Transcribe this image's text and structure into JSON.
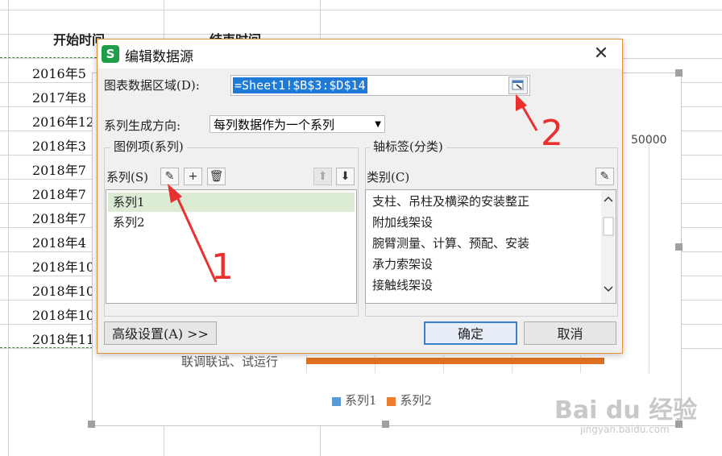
{
  "sheet": {
    "headers": [
      "开始时间",
      "结束时间"
    ],
    "start_dates": [
      "2016年5",
      "2017年8",
      "2016年12",
      "2018年3",
      "2018年7",
      "2018年7",
      "2018年7",
      "2018年4",
      "2018年10",
      "2018年10",
      "2018年10",
      "2018年11"
    ]
  },
  "chart": {
    "axis_value": "50000",
    "row_label": "联调联试、试运行",
    "legend": [
      {
        "name": "系列1",
        "color": "#5b9bd5"
      },
      {
        "name": "系列2",
        "color": "#ed7d31"
      }
    ]
  },
  "dialog": {
    "app_icon": "S",
    "title": "编辑数据源",
    "close_glyph": "✕",
    "range_label": "图表数据区域(D):",
    "range_value": "=Sheet1!$B$3:$D$14",
    "direction_label": "系列生成方向:",
    "direction_value": "每列数据作为一个系列",
    "legend_group_title": "图例项(系列)",
    "series_label": "系列(S)",
    "series_items": [
      "系列1",
      "系列2"
    ],
    "axis_group_title": "轴标签(分类)",
    "category_label": "类别(C)",
    "category_items": [
      "支柱、吊柱及横梁的安装整正",
      "附加线架设",
      "腕臂测量、计算、预配、安装",
      "承力索架设",
      "接触线架设"
    ],
    "advanced_button": "高级设置(A) >>",
    "ok_button": "确定",
    "cancel_button": "取消",
    "toolbar": {
      "edit": "✎",
      "add": "+",
      "delete": "🗑",
      "up": "⬆",
      "down": "⬇"
    }
  },
  "annotations": {
    "one": "1",
    "two": "2"
  },
  "watermark": {
    "brand": "Bai du 经验",
    "url": "jingyan.baidu.com"
  }
}
